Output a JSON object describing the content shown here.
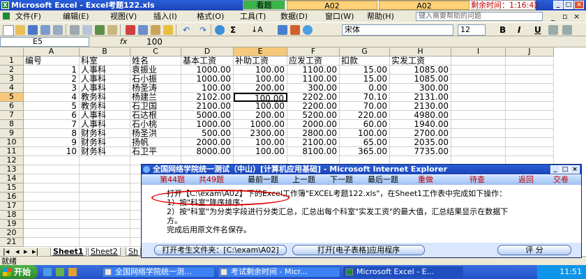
{
  "window": {
    "title": "Microsoft Excel - Excel考题122.xls",
    "exam_view": "看题",
    "exam_a1": "A02",
    "exam_a2": "A02",
    "remaining_time": "剩余时间：1:16:43"
  },
  "menu": [
    "文件(F)",
    "编辑(E)",
    "视图(V)",
    "插入(I)",
    "格式(O)",
    "工具(T)",
    "数据(D)",
    "窗口(W)",
    "帮助(H)"
  ],
  "help_placeholder": "键入需要帮助的问题",
  "toolbar": {
    "sigma": "Σ",
    "font_name": "宋体",
    "font_size": "12",
    "bold": "B",
    "italic": "I",
    "underline": "U"
  },
  "formula_bar": {
    "name_box": "E5",
    "fx": "fx",
    "value": "100"
  },
  "columns": [
    "A",
    "B",
    "C",
    "D",
    "E",
    "F",
    "G",
    "H",
    "I",
    "J"
  ],
  "rows": [
    "1",
    "2",
    "3",
    "4",
    "5",
    "6",
    "7",
    "8",
    "9",
    "10",
    "11",
    "12",
    "13",
    "14",
    "15",
    "16",
    "17",
    "18",
    "19",
    "20",
    "21"
  ],
  "selected_cell": {
    "col": "E",
    "row": "5"
  },
  "table": {
    "headers": [
      "编号",
      "科室",
      "姓名",
      "基本工资",
      "补助工资",
      "应发工资",
      "扣款",
      "实发工资"
    ],
    "records": [
      [
        "1",
        "人事科",
        "袁振业",
        "1000.00",
        "100.00",
        "1100.00",
        "15.00",
        "1085.00"
      ],
      [
        "2",
        "人事科",
        "石小振",
        "1000.00",
        "100.00",
        "1100.00",
        "15.00",
        "1085.00"
      ],
      [
        "3",
        "人事科",
        "杨圣涛",
        "100.00",
        "200.00",
        "300.00",
        "0.00",
        "300.00"
      ],
      [
        "4",
        "教务科",
        "杨建兰",
        "2102.00",
        "100.00",
        "2202.00",
        "70.10",
        "2131.00"
      ],
      [
        "5",
        "教务科",
        "石卫国",
        "2100.00",
        "100.00",
        "2200.00",
        "70.00",
        "2130.00"
      ],
      [
        "6",
        "人事科",
        "石达根",
        "5000.00",
        "200.00",
        "5200.00",
        "220.00",
        "4980.00"
      ],
      [
        "7",
        "人事科",
        "石小桃",
        "1000.00",
        "1000.00",
        "2000.00",
        "60.00",
        "1940.00"
      ],
      [
        "8",
        "财务科",
        "杨圣洪",
        "500.00",
        "2300.00",
        "2800.00",
        "100.00",
        "2700.00"
      ],
      [
        "9",
        "财务科",
        "扬帆",
        "2000.00",
        "100.00",
        "2100.00",
        "65.00",
        "2035.00"
      ],
      [
        "10",
        "财务科",
        "石卫平",
        "8000.00",
        "100.00",
        "8100.00",
        "365.00",
        "7735.00"
      ]
    ]
  },
  "sheet_tabs": [
    "Sheet1",
    "Sheet2",
    "Sh"
  ],
  "status": "就绪",
  "dialog": {
    "title": "全国网络学院统一测试（中山）[计算机应用基础] - Microsoft Internet Explorer",
    "current_label": "第44题",
    "total_label": "共49题",
    "nav": [
      "最前一题",
      "上一题",
      "下一题",
      "最后一题"
    ],
    "status_labels": [
      "重做",
      "待查",
      "返回",
      "交卷"
    ],
    "lines": [
      "打开【C:\\exam\\A02】下的Excel工作簿\"EXCEL考题122.xls\"，在Sheet1工作表中完成如下操作：",
      "1）按\"科室\"降序排序；",
      "2）按\"科室\"为分类字段进行分类汇总，汇总出每个科室\"实发工资\"的最大值，汇总结果显示在数据下",
      "方。",
      "完成后用原文件名保存。"
    ],
    "btn_open_folder": "打开考生文件夹：[C:\\exam\\A02]",
    "btn_open_app": "打开[电子表格]应用程序",
    "btn_score": "评 分"
  },
  "taskbar": {
    "start": "开始",
    "tasks": [
      "全国网络学院统一测...",
      "考试剩余时间 - Micr...",
      "Microsoft Excel - E..."
    ],
    "clock": "11:51"
  },
  "colors": {
    "title_blue": "#1b45b8",
    "selection_orange": "#f5c87b",
    "circle_red": "#e00000",
    "exam_green": "#3bb54a"
  }
}
